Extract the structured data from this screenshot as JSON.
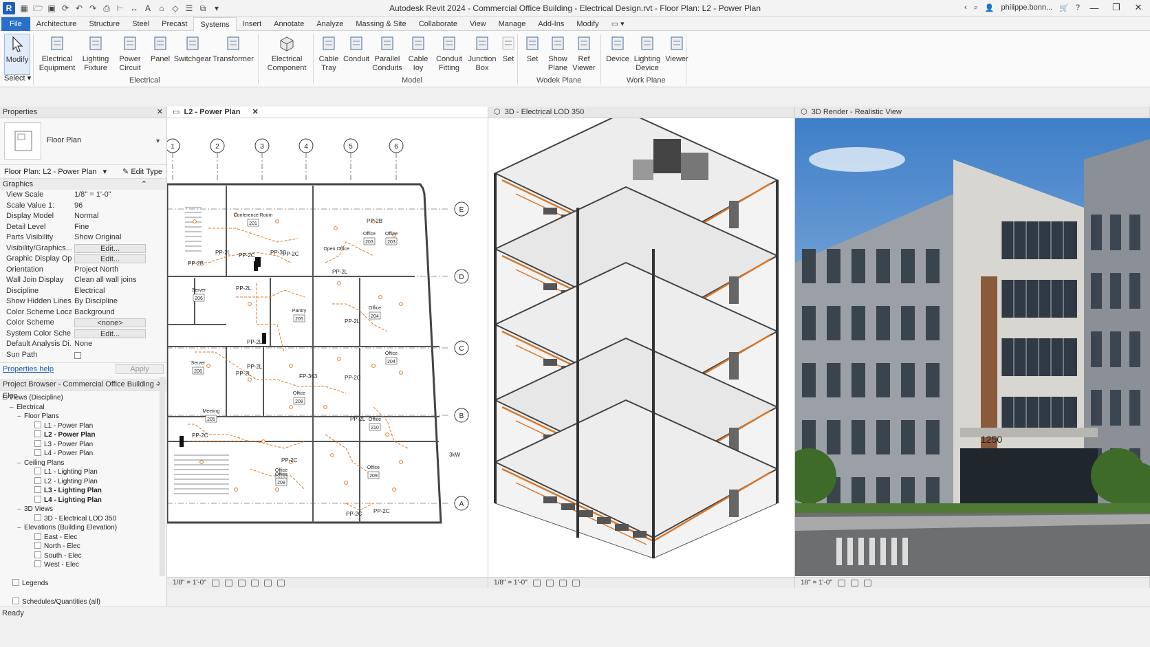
{
  "window": {
    "title": "Autodesk Revit 2024 - Commercial Office Building - Electrical Design.rvt - Floor Plan: L2 - Power Plan",
    "user": "philippe.bonn...",
    "logo": "R"
  },
  "tabs": [
    "File",
    "Architecture",
    "Structure",
    "Steel",
    "Precast",
    "Systems",
    "Insert",
    "Annotate",
    "Analyze",
    "Massing & Site",
    "Collaborate",
    "View",
    "Manage",
    "Add-Ins",
    "Modify"
  ],
  "active_tab": "Systems",
  "ribbon": {
    "modify": "Modify",
    "select": "Select",
    "electrical_buttons": [
      {
        "l1": "Electrical",
        "l2": "Equipment",
        "icon": "electrical-equipment-icon"
      },
      {
        "l1": "Lighting",
        "l2": "Fixture",
        "icon": "lighting-fixture-icon"
      },
      {
        "l1": "Power",
        "l2": "Circuit",
        "icon": "power-circuit-icon"
      },
      {
        "l1": "Panel",
        "l2": "",
        "icon": "panel-icon"
      },
      {
        "l1": "Switchgear",
        "l2": "",
        "icon": "switchgear-icon"
      },
      {
        "l1": "Transformer",
        "l2": "",
        "icon": "transformer-icon"
      }
    ],
    "electrical_label": "Electrical",
    "component": {
      "l1": "Electrical",
      "l2": "Component"
    },
    "model_buttons": [
      {
        "l1": "Cable",
        "l2": "Tray",
        "icon": "cable-tray-icon"
      },
      {
        "l1": "Conduit",
        "l2": "",
        "icon": "conduit-icon"
      },
      {
        "l1": "Parallel",
        "l2": "Conduits",
        "icon": "parallel-conduits-icon"
      },
      {
        "l1": "Cable",
        "l2": "Ioy",
        "icon": "cable-icon"
      },
      {
        "l1": "Conduit",
        "l2": "Fitting",
        "icon": "conduit-fitting-icon"
      },
      {
        "l1": "Junction",
        "l2": "Box",
        "icon": "junction-box-icon"
      },
      {
        "l1": "Set",
        "l2": "",
        "icon": "set-disabled-icon"
      }
    ],
    "model_label": "Model",
    "workplane_buttons": [
      {
        "l1": "Set",
        "l2": "",
        "icon": "set-workplane-icon"
      },
      {
        "l1": "Show",
        "l2": "Plane",
        "icon": "show-plane-icon"
      },
      {
        "l1": "Ref",
        "l2": "Viewer",
        "icon": "ref-viewer-icon"
      }
    ],
    "workplane_label": "Wodek Plane",
    "device_buttons": [
      {
        "l1": "Device",
        "l2": "",
        "icon": "device-icon"
      },
      {
        "l1": "Lighting",
        "l2": "Device",
        "icon": "lighting-device-icon"
      },
      {
        "l1": "Viewer",
        "l2": "",
        "icon": "viewer-icon"
      }
    ],
    "workplane2_label": "Work Plane"
  },
  "properties": {
    "title": "Properties",
    "type_name": "Floor Plan",
    "instance": "Floor Plan: L2 - Power Plan",
    "edit_type": "Edit Type",
    "group": "Graphics",
    "rows": [
      {
        "k": "View Scale",
        "v": "1/8\" = 1'-0\""
      },
      {
        "k": "Scale Value    1:",
        "v": "96"
      },
      {
        "k": "Display Model",
        "v": "Normal"
      },
      {
        "k": "Detail Level",
        "v": "Fine"
      },
      {
        "k": "Parts Visibility",
        "v": "Show Original"
      },
      {
        "k": "Visibility/Graphics...",
        "v": "Edit..."
      },
      {
        "k": "Graphic Display Op...",
        "v": "Edit..."
      },
      {
        "k": "Orientation",
        "v": "Project North"
      },
      {
        "k": "Wall Join Display",
        "v": "Clean all wall joins"
      },
      {
        "k": "Discipline",
        "v": "Electrical"
      },
      {
        "k": "Show Hidden Lines",
        "v": "By Discipline"
      },
      {
        "k": "Color Scheme Loca...",
        "v": "Background"
      },
      {
        "k": "Color Scheme",
        "v": "<none>"
      },
      {
        "k": "System Color Sche...",
        "v": "Edit..."
      },
      {
        "k": "Default Analysis Di...",
        "v": "None"
      },
      {
        "k": "Sun Path",
        "v": ""
      }
    ],
    "help": "Properties help",
    "apply": "Apply"
  },
  "browser": {
    "title": "Project Browser - Commercial Office Building - Elec",
    "root": "Views (Discipline)",
    "electrical": "Electrical",
    "floor_plans": "Floor Plans",
    "fp_items": [
      "L1 - Power Plan",
      "L2 - Power Plan",
      "L3 - Power Plan",
      "L4 - Power Plan"
    ],
    "ceiling_plans": "Ceiling Plans",
    "cp_items": [
      "L1 - Lighting Plan",
      "L2 - Lighting Plan",
      "L3 - Lighting Plan",
      "L4 - Lighting Plan"
    ],
    "views_3d": "3D Views",
    "v3d_items": [
      "3D - Electrical LOD 350"
    ],
    "elevations": "Elevations (Building Elevation)",
    "el_items": [
      "East - Elec",
      "North - Elec",
      "South - Elec",
      "West - Elec"
    ],
    "legends": "Legends",
    "schedules": "Schedules/Quantities (all)"
  },
  "views": {
    "plan_tab": "L2 - Power Plan",
    "plan_scale": "1/8\" = 1'-0\"",
    "iso_tab": "3D - Electrical LOD 350",
    "iso_scale": "1/8\" = 1'-0\"",
    "render_tab": "3D Render - Realistic View",
    "render_scale": "18\" = 1'-0\"",
    "building_number": "1250"
  },
  "plan": {
    "grid_cols": [
      "1",
      "2",
      "3",
      "4",
      "5",
      "6"
    ],
    "grid_rows": [
      "E",
      "D",
      "C",
      "B",
      "A"
    ],
    "rooms": [
      {
        "name": "Conference Room",
        "num": "201"
      },
      {
        "name": "Office",
        "num": "203"
      },
      {
        "name": "Office",
        "num": "203"
      },
      {
        "name": "Open Office",
        "num": ""
      },
      {
        "name": "Server",
        "num": "206"
      },
      {
        "name": "Pantry",
        "num": "205"
      },
      {
        "name": "Office",
        "num": "204"
      },
      {
        "name": "Office",
        "num": "204"
      },
      {
        "name": "Server",
        "num": "206"
      },
      {
        "name": "Office",
        "num": "208"
      },
      {
        "name": "Meeting",
        "num": "205"
      },
      {
        "name": "Office",
        "num": "210"
      },
      {
        "name": "Office",
        "num": "210"
      },
      {
        "name": "Office",
        "num": "209"
      },
      {
        "name": "Office",
        "num": "208"
      }
    ],
    "panels": [
      "PP-2B",
      "PP-2L",
      "PP-2C",
      "PP-3C",
      "PP-2C",
      "PP-2B",
      "PP-2L",
      "PP-2L",
      "PP-2L",
      "PP-2L",
      "PP-2L",
      "FP-363",
      "PP-2C",
      "PP-2L",
      "PP-2C",
      "PP-2C",
      "PP-2L",
      "PP-2C",
      "PP-2C",
      "3kW"
    ]
  },
  "status": "Ready"
}
